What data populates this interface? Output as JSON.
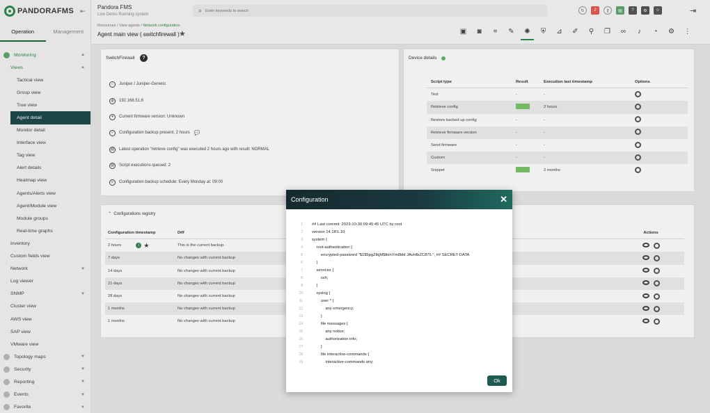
{
  "sidebar": {
    "brand": "PANDORAFMS",
    "tabs": [
      "Operation",
      "Management"
    ],
    "items": [
      {
        "label": "Monitoring",
        "level": 0,
        "green": true,
        "chev": "▲",
        "icon": true
      },
      {
        "label": "Views",
        "level": 1,
        "green": true,
        "chev": "▲"
      },
      {
        "label": "Tactical view",
        "level": 2
      },
      {
        "label": "Group view",
        "level": 2
      },
      {
        "label": "Tree view",
        "level": 2
      },
      {
        "label": "Agent detail",
        "level": 2,
        "selected": true
      },
      {
        "label": "Monitor detail",
        "level": 2
      },
      {
        "label": "Interface view",
        "level": 2
      },
      {
        "label": "Tag view",
        "level": 2
      },
      {
        "label": "Alert details",
        "level": 2
      },
      {
        "label": "Heatmap view",
        "level": 2
      },
      {
        "label": "Agents/Alerts view",
        "level": 2
      },
      {
        "label": "Agent/Module view",
        "level": 2
      },
      {
        "label": "Module groups",
        "level": 2
      },
      {
        "label": "Real-time graphs",
        "level": 2
      },
      {
        "label": "Inventory",
        "level": 1
      },
      {
        "label": "Custom fields view",
        "level": 1
      },
      {
        "label": "Network",
        "level": 1,
        "chev": "▼"
      },
      {
        "label": "Log viewer",
        "level": 1
      },
      {
        "label": "SNMP",
        "level": 1,
        "chev": "▼"
      },
      {
        "label": "Cluster view",
        "level": 1
      },
      {
        "label": "AWS view",
        "level": 1
      },
      {
        "label": "SAP view",
        "level": 1
      },
      {
        "label": "VMware view",
        "level": 1
      },
      {
        "label": "Topology maps",
        "level": 0,
        "chev": "▼",
        "icon": true
      },
      {
        "label": "Security",
        "level": 0,
        "chev": "▼",
        "icon": true
      },
      {
        "label": "Reporting",
        "level": 0,
        "chev": "▼",
        "icon": true
      },
      {
        "label": "Events",
        "level": 0,
        "chev": "▼",
        "icon": true
      },
      {
        "label": "Favorite",
        "level": 0,
        "chev": "▼",
        "icon": true
      }
    ]
  },
  "header": {
    "app_title": "Pandora FMS",
    "app_subtitle": "Live Demo Running system",
    "search_placeholder": "Enter keywords to search",
    "badge_count": "2",
    "breadcrumb_prefix": "Resources / View agents / ",
    "breadcrumb_current": "Network configuration",
    "page_title": "Agent main view ( switchfirewall )"
  },
  "device_panel": {
    "title": "SwitchFirewall",
    "rows": [
      {
        "icon": "tag",
        "text": "Juniper /  Juniper-Generic"
      },
      {
        "icon": "globe",
        "text": "192.168.51.6"
      },
      {
        "icon": "shield",
        "text": "Current firmware version: Unknown"
      },
      {
        "icon": "check",
        "text": "Configuration backup present, 2 hours"
      },
      {
        "icon": "doc",
        "text": "Latest operation \"retrieve config\" was executed 2 hours ago with result: NORMAL"
      },
      {
        "icon": "doc",
        "text": "Script executions queued: 2"
      },
      {
        "icon": "db",
        "text": "Configuration backup schedule: Every Monday at: 09:00"
      }
    ]
  },
  "details_panel": {
    "title": "Device details",
    "headers": [
      "Script type",
      "Result",
      "Execution last timestamp",
      "Options"
    ],
    "rows": [
      {
        "type": "Test",
        "result": "-",
        "ts": "-"
      },
      {
        "type": "Retrieve config",
        "result": "ok",
        "ts": "2 hours"
      },
      {
        "type": "Restore backed up config",
        "result": "-",
        "ts": "-"
      },
      {
        "type": "Retrieve firmware version",
        "result": "-",
        "ts": "-"
      },
      {
        "type": "Send firmware",
        "result": "-",
        "ts": "-"
      },
      {
        "type": "Custom",
        "result": "-",
        "ts": "-"
      },
      {
        "type": "Snippet",
        "result": "ok",
        "ts": "2 months"
      }
    ]
  },
  "registry": {
    "title": "Configurations registry",
    "headers": [
      "Configuration timestamp",
      "Diff",
      "Actions"
    ],
    "rows": [
      {
        "ts": "2 hours",
        "diff": "This is the current backup.",
        "current": true
      },
      {
        "ts": "7 days",
        "diff": "No changes with current backup"
      },
      {
        "ts": "14 days",
        "diff": "No changes with current backup"
      },
      {
        "ts": "21 days",
        "diff": "No changes with current backup"
      },
      {
        "ts": "28 days",
        "diff": "No changes with current backup"
      },
      {
        "ts": "1 months",
        "diff": "No changes with current backup"
      },
      {
        "ts": "1 months",
        "diff": "No changes with current backup"
      }
    ]
  },
  "modal": {
    "title": "Configuration",
    "ok_label": "Ok",
    "code": [
      "## Last commit: 2023-10-30 09:45:45 UTC by root",
      "version 14.1R1.10;",
      "system {",
      "    root-authentication {",
      "        encrypted-password \"$1$5pgZtkjM$tktnYm8ldd JAvHlbZC875.\"; ## SECRET-DATA",
      "    }",
      "    services {",
      "        ssh;",
      "    }",
      "    syslog {",
      "        user * {",
      "            any emergency;",
      "        }",
      "        file messages {",
      "            any notice;",
      "            authorization info;",
      "        }",
      "        file interactive-commands {",
      "            interactive-commands any;"
    ]
  }
}
